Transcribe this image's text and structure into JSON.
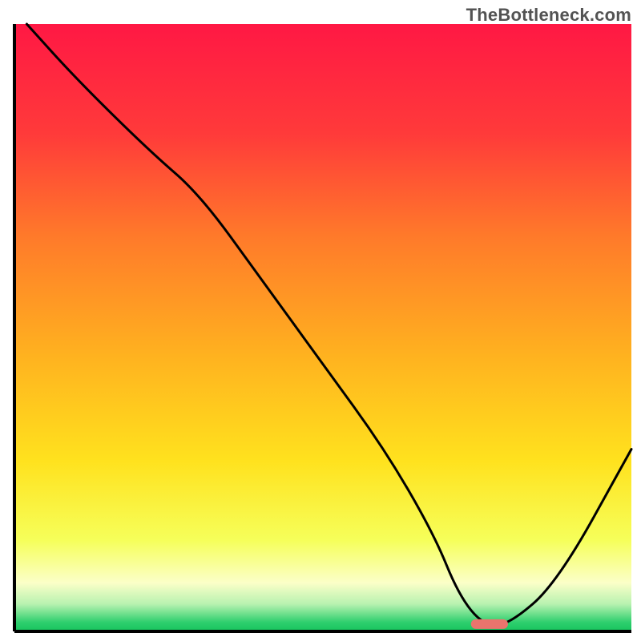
{
  "watermark": "TheBottleneck.com",
  "chart_data": {
    "type": "line",
    "title": "",
    "xlabel": "",
    "ylabel": "",
    "xlim": [
      0,
      100
    ],
    "ylim": [
      0,
      100
    ],
    "grid": false,
    "legend": false,
    "background_gradient": {
      "stops": [
        {
          "offset": 0.0,
          "color": "#ff1844"
        },
        {
          "offset": 0.18,
          "color": "#ff3a3a"
        },
        {
          "offset": 0.35,
          "color": "#ff7a2a"
        },
        {
          "offset": 0.55,
          "color": "#ffb31f"
        },
        {
          "offset": 0.72,
          "color": "#ffe21e"
        },
        {
          "offset": 0.85,
          "color": "#f6ff5a"
        },
        {
          "offset": 0.92,
          "color": "#fbffc8"
        },
        {
          "offset": 0.955,
          "color": "#b8f2b0"
        },
        {
          "offset": 0.985,
          "color": "#2ecf6e"
        },
        {
          "offset": 1.0,
          "color": "#17c45d"
        }
      ]
    },
    "series": [
      {
        "name": "bottleneck-curve",
        "x": [
          2,
          10,
          22,
          30,
          40,
          50,
          60,
          68,
          72,
          76,
          80,
          88,
          100
        ],
        "y": [
          100,
          91,
          79,
          72,
          58,
          44,
          30,
          16,
          6,
          1,
          1,
          8,
          30
        ]
      }
    ],
    "marker": {
      "name": "optimal-point",
      "x": 77,
      "y": 1.2,
      "width": 6,
      "color": "#e9746d"
    }
  }
}
